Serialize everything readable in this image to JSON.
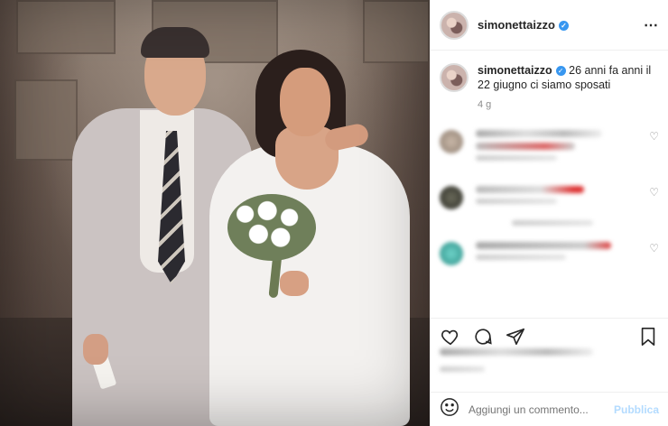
{
  "post": {
    "username": "simonettaizzo",
    "caption": "26 anni fa anni il 22 giugno ci siamo sposati",
    "time_ago": "4 g",
    "more_icon": "more-horizontal-icon"
  },
  "comments": {
    "blurred": true
  },
  "comment_box": {
    "placeholder": "Aggiungi un commento...",
    "publish_label": "Pubblica"
  },
  "icons": {
    "like": "heart-icon",
    "comment": "comment-icon",
    "share": "share-icon",
    "save": "bookmark-icon",
    "emoji": "smiley-icon"
  },
  "colors": {
    "accent": "#3897f0",
    "publish_disabled": "#b3dbff",
    "border": "#efefef",
    "muted": "#8e8e8e"
  }
}
